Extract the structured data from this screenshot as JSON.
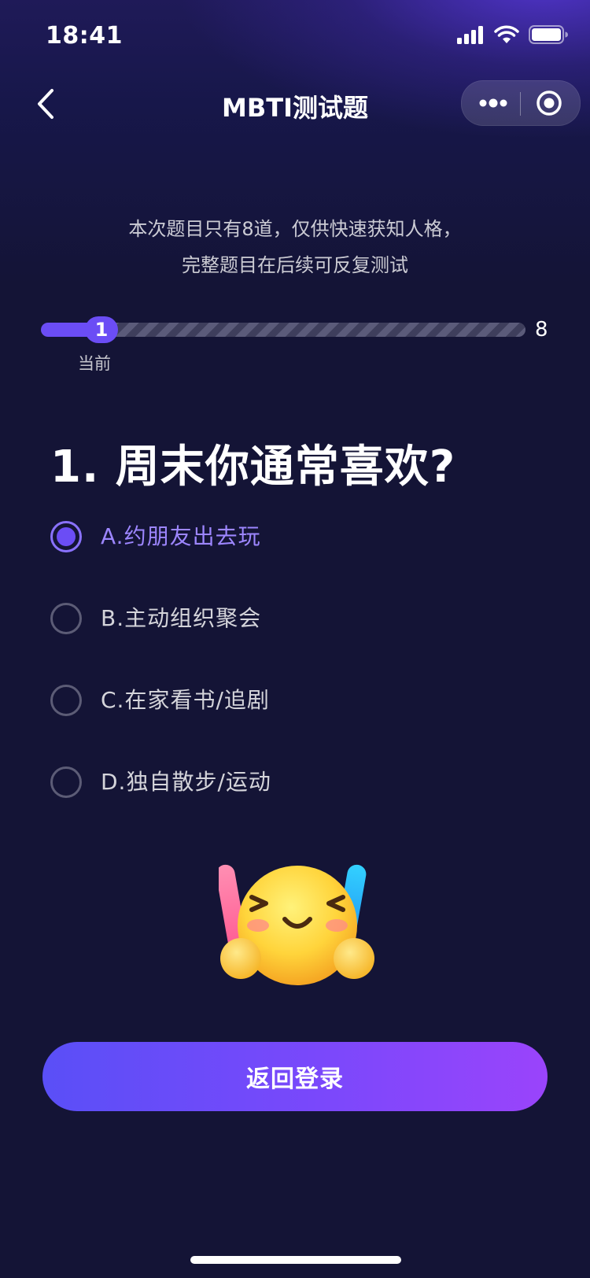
{
  "status_bar": {
    "time": "18:41"
  },
  "nav": {
    "title": "MBTI测试题"
  },
  "intro": {
    "line1": "本次题目只有8道，仅供快速获知人格，",
    "line2": "完整题目在后续可反复测试"
  },
  "progress": {
    "current": "1",
    "total": "8",
    "current_label": "当前",
    "fraction": 0.125
  },
  "question": {
    "title": "1. 周末你通常喜欢?"
  },
  "options": [
    {
      "label": "A.约朋友出去玩",
      "selected": true
    },
    {
      "label": "B.主动组织聚会",
      "selected": false
    },
    {
      "label": "C.在家看书/追剧",
      "selected": false
    },
    {
      "label": "D.独自散步/运动",
      "selected": false
    }
  ],
  "cta": {
    "label": "返回登录"
  },
  "colors": {
    "accent": "#6b4df5",
    "background": "#141436",
    "selected_text": "#9d86ff"
  }
}
